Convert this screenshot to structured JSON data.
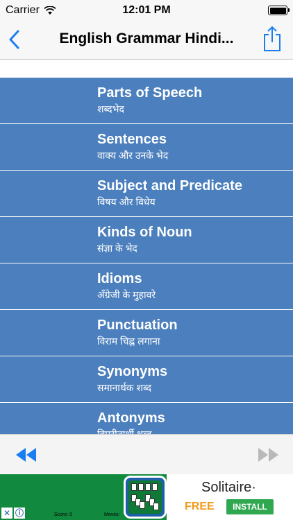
{
  "status": {
    "carrier": "Carrier",
    "time": "12:01 PM"
  },
  "nav": {
    "title": "English Grammar Hindi..."
  },
  "lessons": [
    {
      "title": "Parts of Speech",
      "subtitle": "शब्दभेद"
    },
    {
      "title": "Sentences",
      "subtitle": "वाक्य और उनके भेद"
    },
    {
      "title": "Subject and Predicate",
      "subtitle": "विषय और विधेय"
    },
    {
      "title": "Kinds of Noun",
      "subtitle": "संज्ञा के भेद"
    },
    {
      "title": "Idioms",
      "subtitle": "अँग्रेजी के मुहावरे"
    },
    {
      "title": "Punctuation",
      "subtitle": "विराम चिह्न लगाना"
    },
    {
      "title": "Synonyms",
      "subtitle": "समानार्थक शब्द"
    },
    {
      "title": "Antonyms",
      "subtitle": "विपरीतार्थी शब्द"
    }
  ],
  "ad": {
    "app_name": "Solitaire·",
    "free_label": "FREE",
    "install_label": "INSTALL",
    "score_label": "Score: 0",
    "moves_label": "Moves:"
  },
  "colors": {
    "list_background": "#4b7fbd",
    "accent_blue": "#1a7ef2",
    "ad_green": "#118a3f"
  }
}
